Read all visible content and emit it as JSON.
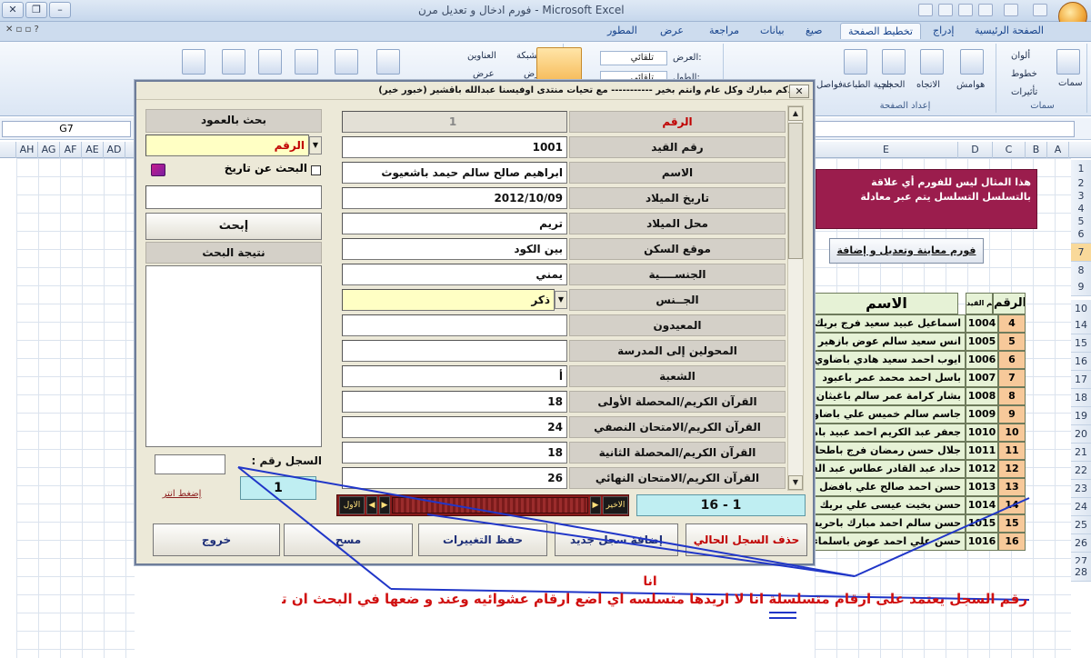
{
  "window": {
    "title": "فورم ادخال و تعديل مرن - Microsoft Excel"
  },
  "ribbon": {
    "tabs": [
      "الصفحة الرئيسية",
      "إدراج",
      "تخطيط الصفحة",
      "صيغ",
      "بيانات",
      "مراجعة",
      "عرض",
      "المطور"
    ],
    "active_tab": "تخطيط الصفحة",
    "groups": {
      "themes": {
        "label": "سمات",
        "items": [
          "ألوان",
          "خطوط",
          "تأثيرات",
          "سمات"
        ]
      },
      "page_setup": {
        "label": "إعداد الصفحة",
        "items": [
          "هوامش",
          "الاتجاه",
          "الحجم",
          "ناحية الطباعة",
          "فواصل"
        ]
      },
      "scale": {
        "width_label": "العرض:",
        "width_value": "تلقائي",
        "height_label": "الطول:",
        "height_value": "تلقائي"
      },
      "sheet_options": {
        "gridlines": "خطوط الشبكة",
        "headings": "العناوين",
        "view_gridlines": "عرض",
        "view_headings": "عرض"
      }
    }
  },
  "formula_bar": {
    "name_box": "G7"
  },
  "columns_left": [
    "AH",
    "AG",
    "AF",
    "AE",
    "AD"
  ],
  "columns_right": [
    "E",
    "D",
    "C",
    "B",
    "A"
  ],
  "row_numbers": [
    "1",
    "2",
    "3",
    "4",
    "5",
    "6",
    "7",
    "8",
    "9",
    "10",
    "14",
    "15",
    "16",
    "17",
    "18",
    "19",
    "20",
    "21",
    "22",
    "23",
    "24",
    "25",
    "26",
    "27",
    "28"
  ],
  "selected_row": "7",
  "sheet": {
    "note": "هذا المثال ليس للفورم أي علاقة بالتسلسل التسلسل يتم عبر معادلة",
    "button": "فورم معاينة وتعديل و إضافة",
    "header": {
      "num": "الرقم",
      "code": "رقم القيد",
      "name": "الاسم"
    },
    "rows": [
      {
        "num": "4",
        "code": "1004",
        "name": "اسماعيل عبيد سعيد فرج بريك"
      },
      {
        "num": "5",
        "code": "1005",
        "name": "انس سعيد سالم عوض بازهير"
      },
      {
        "num": "6",
        "code": "1006",
        "name": "ايوب احمد سعيد هادي باضاوي"
      },
      {
        "num": "7",
        "code": "1007",
        "name": "باسل احمد محمد عمر باعبود"
      },
      {
        "num": "8",
        "code": "1008",
        "name": "بشار كرامة عمر سالم باغيثان"
      },
      {
        "num": "9",
        "code": "1009",
        "name": "جاسم سالم خميس علي باضاوي"
      },
      {
        "num": "10",
        "code": "1010",
        "name": "جعفر عبد الكريم احمد عبيد بامقيشم"
      },
      {
        "num": "11",
        "code": "1011",
        "name": "جلال حسن رمضان فرج باطحان"
      },
      {
        "num": "12",
        "code": "1012",
        "name": "حداد عبد القادر عطاس عبد القادر الكاف"
      },
      {
        "num": "13",
        "code": "1013",
        "name": "حسن احمد صالح علي بافضل"
      },
      {
        "num": "14",
        "code": "1014",
        "name": "حسن بخيت عيسى علي بريك"
      },
      {
        "num": "15",
        "code": "1015",
        "name": "حسن سالم احمد مبارك باحريش"
      },
      {
        "num": "16",
        "code": "1016",
        "name": "حسن علي احمد عوض باسلماء"
      }
    ]
  },
  "dialog": {
    "title": "(عيدكم مبارك وكل عام وانتم بخير ----------- مع تحيات منتدى اوفيسنا عبدالله باقشير (خبور خير)",
    "search": {
      "by_column_label": "بحث بالعمود",
      "column_value": "الرقم",
      "date_search_label": "البحث عن تاريخ",
      "search_button": "إبحث",
      "result_label": "نتيجة البحث"
    },
    "fields": [
      {
        "label": "الرقم",
        "value": "1"
      },
      {
        "label": "رقم القيد",
        "value": "1001"
      },
      {
        "label": "الاسم",
        "value": "ابراهيم صالح سالم حيمد باشعيوث"
      },
      {
        "label": "تاريخ الميلاد",
        "value": "2012/10/09"
      },
      {
        "label": "محل الميلاد",
        "value": "تريم"
      },
      {
        "label": "موقع السكن",
        "value": "بين الكود"
      },
      {
        "label": "الجنســــية",
        "value": "يمني"
      },
      {
        "label": "الجــنس",
        "value": "ذكر"
      },
      {
        "label": "المعيدون",
        "value": ""
      },
      {
        "label": "المحولين إلى المدرسة",
        "value": ""
      },
      {
        "label": "الشعبة",
        "value": "أ"
      },
      {
        "label": "القرآن الكريم/المحصلة الأولى",
        "value": "18"
      },
      {
        "label": "القرآن الكريم/الامتحان النصفي",
        "value": "24"
      },
      {
        "label": "القرآن الكريم/المحصلة الثانية",
        "value": "18"
      },
      {
        "label": "القرآن الكريم/الامتحان النهائي",
        "value": "26"
      }
    ],
    "record": {
      "label": "السجل رقم :",
      "value": "1",
      "press_link": "إضغط انتر"
    },
    "nav": {
      "last_label": "الاخير",
      "first_label": "الاول",
      "counter": "16 - 1"
    },
    "buttons": {
      "delete": "حذف السجل الحالي",
      "add": "إضافة سجل جديد",
      "save": "حفظ التغييرات",
      "clear": "مسح",
      "exit": "خروج"
    }
  },
  "annotation": {
    "ana": "انا",
    "text": "رقم السجل يعتمد على ارقام متسلسلة انا لا اريدها متسلسه اي اضع ارقام عشوائيه وعند و ضعها في البحث ان تجلب البيانات"
  },
  "colors": {
    "note_bg": "#9b1d4d",
    "annotation_red": "#d01010",
    "annotation_blue": "#2036c8",
    "nav_bar": "#8b1c1c",
    "counter_bg": "#bfeef2"
  }
}
